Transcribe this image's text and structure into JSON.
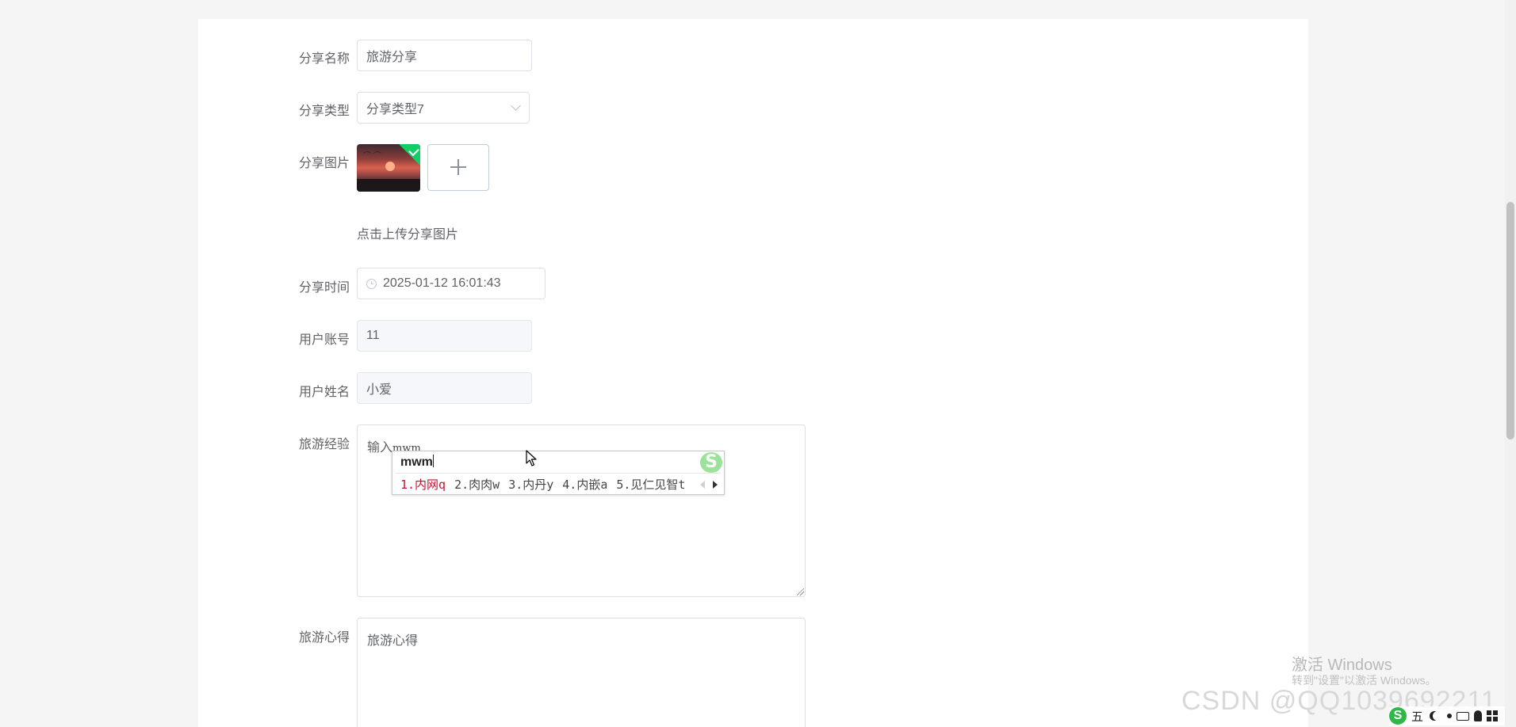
{
  "form": {
    "share_name": {
      "label": "分享名称",
      "value": "旅游分享"
    },
    "share_type": {
      "label": "分享类型",
      "value": "分享类型7"
    },
    "share_image": {
      "label": "分享图片",
      "hint": "点击上传分享图片"
    },
    "share_time": {
      "label": "分享时间",
      "value": "2025-01-12 16:01:43"
    },
    "user_account": {
      "label": "用户账号",
      "value": "11"
    },
    "user_name": {
      "label": "用户姓名",
      "value": "小爱"
    },
    "travel_experience": {
      "label": "旅游经验",
      "value": "输入",
      "composing": "mwm"
    },
    "travel_insight": {
      "label": "旅游心得",
      "placeholder": "旅游心得"
    }
  },
  "ime": {
    "composition": "mwm",
    "logo": "S",
    "candidates": [
      "1.内网q",
      "2.肉肉w",
      "3.内丹y",
      "4.内嵌a",
      "5.见仁见智t"
    ]
  },
  "watermark": {
    "title": "激活 Windows",
    "subtitle": "转到\"设置\"以激活 Windows。",
    "csdn": "CSDN @QQ1039692211"
  },
  "tray": {
    "ime_brand": "S",
    "wubi": "五"
  },
  "colors": {
    "success": "#13ce66",
    "border": "#dcdfe6",
    "disabled_bg": "#f5f7fa",
    "candidate_active": "#c8102e"
  },
  "icons": {
    "select_arrow": "chevron-down-icon",
    "time": "clock-icon",
    "upload": "plus-icon",
    "uploaded": "check-icon",
    "cursor": "mouse-pointer-icon"
  }
}
